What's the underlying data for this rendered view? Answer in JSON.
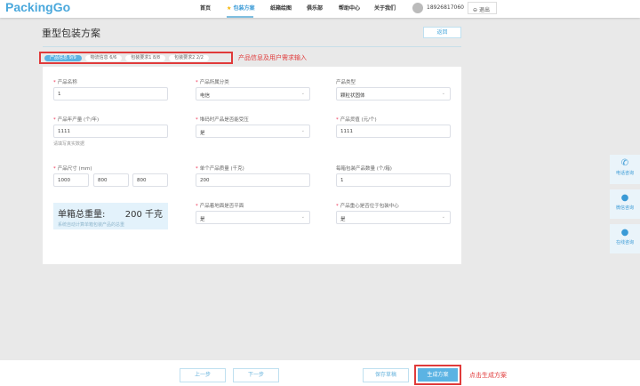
{
  "header": {
    "logo": "PackingGo",
    "nav": [
      {
        "label": "首页"
      },
      {
        "label": "包装方案",
        "active": true
      },
      {
        "label": "纸箱绘图"
      },
      {
        "label": "俱乐部"
      },
      {
        "label": "帮助中心"
      },
      {
        "label": "关于我们"
      }
    ],
    "phone": "18926817060",
    "logout": "退出"
  },
  "page": {
    "title": "重型包装方案",
    "return": "返回"
  },
  "tabs": [
    {
      "label": "产品信息 9/9",
      "active": true
    },
    {
      "label": "物流信息 6/6"
    },
    {
      "label": "包装要求1 8/8"
    },
    {
      "label": "包装要求2 2/2"
    }
  ],
  "annotations": {
    "tabs": "产品信息及用户需求输入",
    "generate": "点击生成方案"
  },
  "form": {
    "name": {
      "label": "产品名称",
      "value": "1"
    },
    "category": {
      "label": "产品所属分类",
      "value": "电信"
    },
    "type": {
      "label": "产品类型",
      "value": "颗粒状固体"
    },
    "annual": {
      "label": "产品年产量 (个/年)",
      "value": "1111",
      "hint": "请填写真实数据"
    },
    "stack": {
      "label": "堆码时产品是否能受压",
      "value": "是"
    },
    "price": {
      "label": "产品货值 (元/个)",
      "value": "1111"
    },
    "size": {
      "label": "产品尺寸 (mm)",
      "values": [
        "1000",
        "800",
        "800"
      ]
    },
    "unit_weight": {
      "label": "单个产品质量 (千克)",
      "value": "200"
    },
    "per_box": {
      "label": "每箱包装产品数量 (个/箱)",
      "value": "1"
    },
    "flat": {
      "label": "产品着地面是否平面",
      "value": "是"
    },
    "center": {
      "label": "产品重心是否位于包装中心",
      "value": "是"
    },
    "total": {
      "label": "单箱总重量:",
      "value": "200 千克",
      "hint": "系统自动计算单箱包装产品的总重"
    }
  },
  "side": [
    {
      "icon": "phone-icon",
      "label": "电话咨询"
    },
    {
      "icon": "wechat-icon",
      "label": "微信咨询"
    },
    {
      "icon": "chat-icon",
      "label": "在线咨询"
    }
  ],
  "footer": {
    "prev": "上一步",
    "next": "下一步",
    "save": "保存草稿",
    "generate": "生成方案"
  },
  "colors": {
    "accent": "#5bb3e3",
    "annotation": "#e03a3a"
  }
}
